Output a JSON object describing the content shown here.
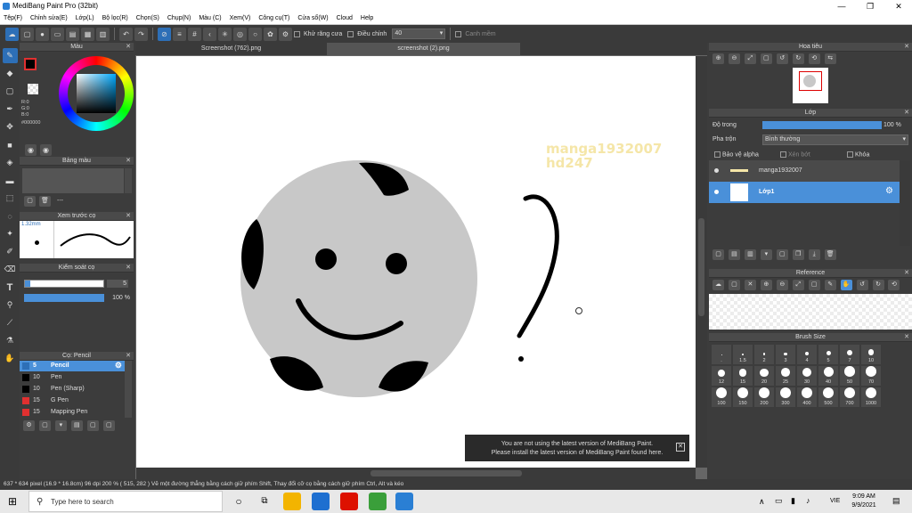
{
  "window": {
    "title": "MediBang Paint Pro (32bit)",
    "minimize": "—",
    "maximize": "❐",
    "close": "✕"
  },
  "menu": [
    "Tệp(F)",
    "Chỉnh sửa(E)",
    "Lớp(L)",
    "Bộ lọc(R)",
    "Chọn(S)",
    "Chụp(N)",
    "Màu (C)",
    "Xem(V)",
    "Công cụ(T)",
    "Cửa sổ(W)",
    "Cloud",
    "Help"
  ],
  "toolbar": {
    "antialias_label": "Khử răng cưa",
    "adjust_label": "Điều chỉnh",
    "adjust_value": "40",
    "snap_label": "Canh mềm"
  },
  "color_panel": {
    "title": "Màu",
    "r": "R:0",
    "g": "G:0",
    "b": "B:0",
    "hex": "#000000"
  },
  "palette_panel": {
    "title": "Bảng màu",
    "dash": "---"
  },
  "preview_panel": {
    "title": "Xem trước cọ",
    "size": "1.32mm"
  },
  "brush_control": {
    "title": "Kiểm soát cọ",
    "size_value": "5",
    "opacity_value": "100 %"
  },
  "brush_list": {
    "title": "Cọ: Pencil",
    "items": [
      {
        "size": "5",
        "name": "Pencil",
        "color": "#2d6fb7",
        "selected": true
      },
      {
        "size": "10",
        "name": "Pen",
        "color": "#000000",
        "selected": false
      },
      {
        "size": "10",
        "name": "Pen (Sharp)",
        "color": "#000000",
        "selected": false
      },
      {
        "size": "15",
        "name": "G Pen",
        "color": "#e03030",
        "selected": false
      },
      {
        "size": "15",
        "name": "Mapping Pen",
        "color": "#e03030",
        "selected": false
      }
    ]
  },
  "tabs": [
    {
      "label": "Screenshot (762).png",
      "active": false
    },
    {
      "label": "screenshot (2).png",
      "active": true
    }
  ],
  "canvas": {
    "watermark_line1": "manga1932007",
    "watermark_line2": "hd247"
  },
  "navigator": {
    "title": "Hoa tiêu"
  },
  "layer_panel": {
    "title": "Lớp",
    "opacity_label": "Độ trong",
    "opacity_value": "100 %",
    "blend_label": "Pha trộn",
    "blend_value": "Bình thường",
    "protect_alpha": "Bảo vệ alpha",
    "clipping": "Xén bớt",
    "lock": "Khóa",
    "layers": [
      {
        "name": "manga1932007",
        "selected": false
      },
      {
        "name": "Lớp1",
        "selected": true
      }
    ]
  },
  "reference_panel": {
    "title": "Reference"
  },
  "brush_size_panel": {
    "title": "Brush Size",
    "row1": [
      ".",
      "1.5",
      "2",
      "3",
      "4",
      "5",
      "7",
      "10"
    ],
    "row2": [
      "12",
      "15",
      "20",
      "25",
      "30",
      "40",
      "50",
      "70"
    ],
    "row3": [
      "100",
      "150",
      "200",
      "300",
      "400",
      "500",
      "700",
      "1000"
    ]
  },
  "notification": {
    "line1": "You are not using the latest version of MediBang Paint.",
    "line2": "Please install the latest version of MediBang Paint found here.",
    "close": "✕"
  },
  "statusbar": {
    "text": "637 * 634 pixel   (16.9 * 16.8cm)   96 dpi   200 %   ( 515, 282 )   Vẽ một đường thẳng bằng cách giữ phím Shift, Thay đổi cỡ cọ bằng cách giữ phím Ctrl, Alt và kéo"
  },
  "taskbar": {
    "search_placeholder": "Type here to search",
    "lang": "VIE",
    "time": "9:09 AM",
    "date": "9/9/2021"
  }
}
